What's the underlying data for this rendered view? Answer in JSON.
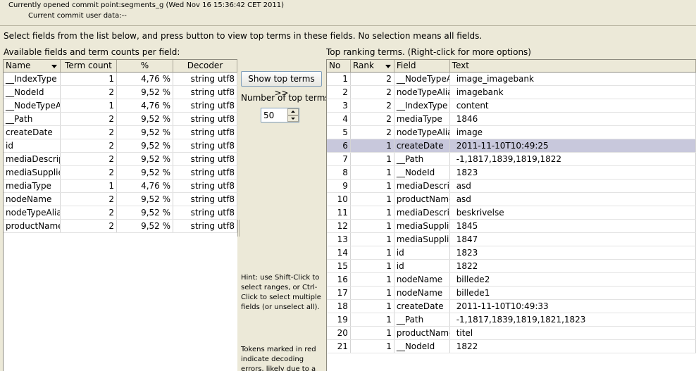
{
  "header": {
    "commit_point": "Currently opened commit point:segments_g (Wed Nov 16 15:36:42 CET 2011)",
    "commit_user_data": "Current commit user data:--"
  },
  "instructions": "Select fields from the list below, and press button to view top terms in these fields. No selection means all fields.",
  "fields_panel": {
    "label": "Available fields and term counts per field:",
    "columns": [
      "Name",
      "Term count",
      "%",
      "Decoder"
    ],
    "rows": [
      [
        "__IndexType",
        "1",
        "4,76 %",
        "string utf8"
      ],
      [
        "__NodeId",
        "2",
        "9,52 %",
        "string utf8"
      ],
      [
        "__NodeTypeAlias",
        "1",
        "4,76 %",
        "string utf8"
      ],
      [
        "__Path",
        "2",
        "9,52 %",
        "string utf8"
      ],
      [
        "createDate",
        "2",
        "9,52 %",
        "string utf8"
      ],
      [
        "id",
        "2",
        "9,52 %",
        "string utf8"
      ],
      [
        "mediaDescription",
        "2",
        "9,52 %",
        "string utf8"
      ],
      [
        "mediaSupplier",
        "2",
        "9,52 %",
        "string utf8"
      ],
      [
        "mediaType",
        "1",
        "4,76 %",
        "string utf8"
      ],
      [
        "nodeName",
        "2",
        "9,52 %",
        "string utf8"
      ],
      [
        "nodeTypeAlias",
        "2",
        "9,52 %",
        "string utf8"
      ],
      [
        "productName",
        "2",
        "9,52 %",
        "string utf8"
      ]
    ]
  },
  "controls": {
    "show_top_terms_label": "Show top terms >>",
    "num_terms_label": "Number of top terms:",
    "num_terms_value": "50",
    "hint": "Hint: use Shift-Click to select ranges, or Ctrl-Click to select multiple fields (or unselect all).",
    "hint_tokens": "Tokens marked in red indicate decoding errors, likely due to a"
  },
  "terms_panel": {
    "label": "Top ranking terms. (Right-click for more options)",
    "columns": [
      "No",
      "Rank",
      "Field",
      "Text"
    ],
    "selected_row": 5,
    "rows": [
      [
        "1",
        "2",
        "__NodeTypeAlias",
        "image_imagebank"
      ],
      [
        "2",
        "2",
        "nodeTypeAlias",
        "imagebank"
      ],
      [
        "3",
        "2",
        "__IndexType",
        "content"
      ],
      [
        "4",
        "2",
        "mediaType",
        "1846"
      ],
      [
        "5",
        "2",
        "nodeTypeAlias",
        "image"
      ],
      [
        "6",
        "1",
        "createDate",
        "2011-11-10T10:49:25"
      ],
      [
        "7",
        "1",
        "__Path",
        "-1,1817,1839,1819,1822"
      ],
      [
        "8",
        "1",
        "__NodeId",
        "1823"
      ],
      [
        "9",
        "1",
        "mediaDescription",
        "asd"
      ],
      [
        "10",
        "1",
        "productName",
        "asd"
      ],
      [
        "11",
        "1",
        "mediaDescription",
        "beskrivelse"
      ],
      [
        "12",
        "1",
        "mediaSupplier",
        "1845"
      ],
      [
        "13",
        "1",
        "mediaSupplier",
        "1847"
      ],
      [
        "14",
        "1",
        "id",
        "1823"
      ],
      [
        "15",
        "1",
        "id",
        "1822"
      ],
      [
        "16",
        "1",
        "nodeName",
        "billede2"
      ],
      [
        "17",
        "1",
        "nodeName",
        "billede1"
      ],
      [
        "18",
        "1",
        "createDate",
        "2011-11-10T10:49:33"
      ],
      [
        "19",
        "1",
        "__Path",
        "-1,1817,1839,1819,1821,1823"
      ],
      [
        "20",
        "1",
        "productName",
        "titel"
      ],
      [
        "21",
        "1",
        "__NodeId",
        "1822"
      ]
    ]
  }
}
